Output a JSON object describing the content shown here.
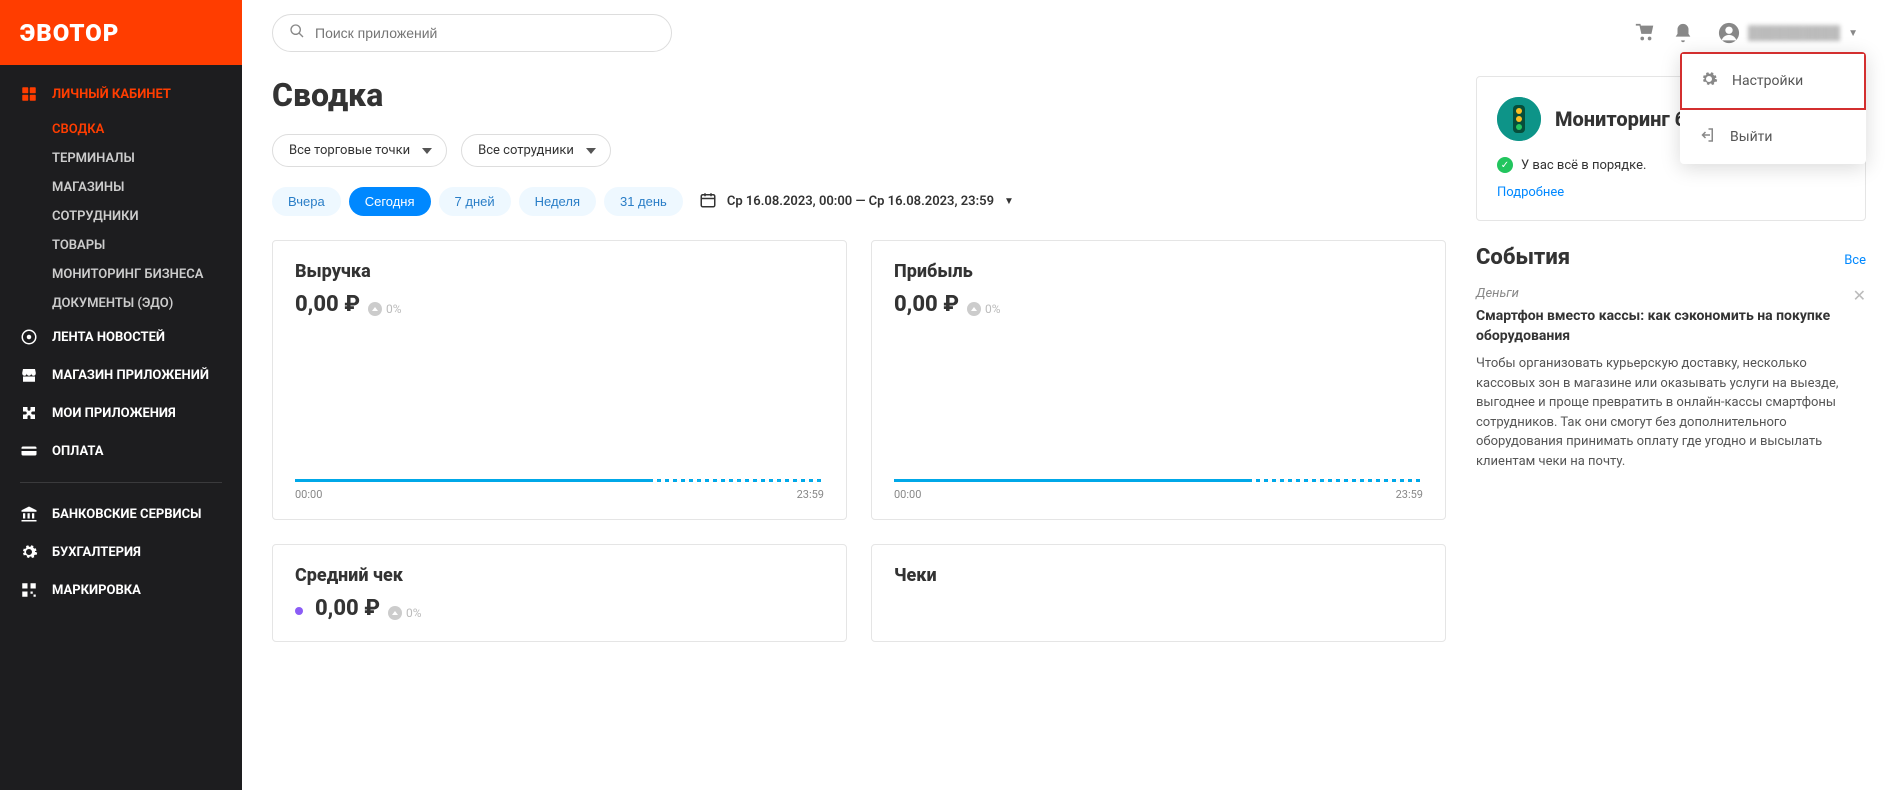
{
  "logo": "ЭВОТОР",
  "search": {
    "placeholder": "Поиск приложений"
  },
  "user": {
    "name_placeholder": "██████████"
  },
  "user_menu": {
    "settings": "Настройки",
    "logout": "Выйти"
  },
  "sidebar": {
    "personal": "ЛИЧНЫЙ КАБИНЕТ",
    "subs": {
      "summary": "СВОДКА",
      "terminals": "ТЕРМИНАЛЫ",
      "stores": "МАГАЗИНЫ",
      "staff": "СОТРУДНИКИ",
      "goods": "ТОВАРЫ",
      "monitoring": "МОНИТОРИНГ БИЗНЕСА",
      "documents": "ДОКУМЕНТЫ (ЭДО)"
    },
    "news": "ЛЕНТА НОВОСТЕЙ",
    "app_store": "МАГАЗИН ПРИЛОЖЕНИЙ",
    "my_apps": "МОИ ПРИЛОЖЕНИЯ",
    "payment": "ОПЛАТА",
    "banking": "БАНКОВСКИЕ СЕРВИСЫ",
    "accounting": "БУХГАЛТЕРИЯ",
    "marking": "МАРКИРОВКА"
  },
  "page_title": "Сводка",
  "filters": {
    "points": "Все торговые точки",
    "staff": "Все сотрудники"
  },
  "periods": {
    "yesterday": "Вчера",
    "today": "Сегодня",
    "7days": "7 дней",
    "week": "Неделя",
    "31days": "31 день"
  },
  "date_range": "Ср 16.08.2023, 00:00 — Ср 16.08.2023, 23:59",
  "cards": {
    "revenue": {
      "title": "Выручка",
      "value": "0,00 ₽",
      "delta": "0%",
      "t_start": "00:00",
      "t_end": "23:59"
    },
    "profit": {
      "title": "Прибыль",
      "value": "0,00 ₽",
      "delta": "0%",
      "t_start": "00:00",
      "t_end": "23:59"
    },
    "avg_check": {
      "title": "Средний чек",
      "value": "0,00 ₽",
      "delta": "0%"
    },
    "checks": {
      "title": "Чеки"
    }
  },
  "side": {
    "monitoring": {
      "title": "Мониторинг бизнеса",
      "status": "У вас всё в порядке.",
      "more": "Подробнее"
    },
    "events": {
      "heading": "События",
      "all": "Все",
      "item": {
        "category": "Деньги",
        "title": "Смартфон вместо кассы: как сэкономить на покупке оборудования",
        "body": "Чтобы организовать курьерскую доставку, несколько кассовых зон в магазине или оказывать услуги на выезде, выгоднее и проще превратить в онлайн-кассы смартфоны сотрудников. Так они смогут без дополнительного оборудования принимать оплату где угодно и высылать клиентам чеки на почту."
      }
    }
  }
}
